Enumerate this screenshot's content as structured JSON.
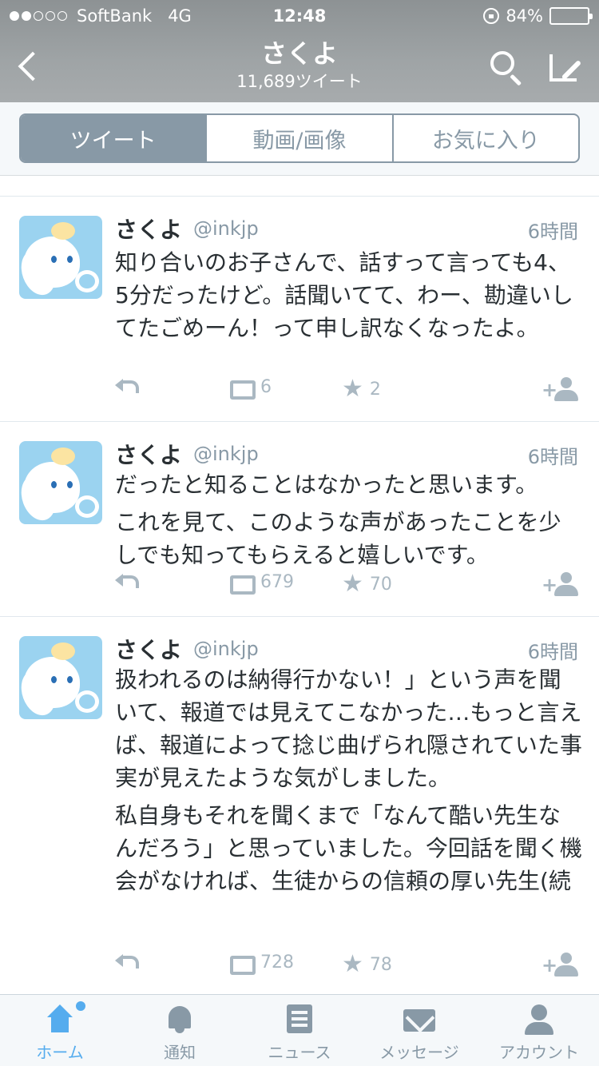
{
  "status_bar": {
    "carrier": "SoftBank",
    "network": "4G",
    "time": "12:48",
    "battery": "84%",
    "battery_level": 0.84
  },
  "nav": {
    "title": "さくよ",
    "subtitle": "11,689ツイート"
  },
  "tabs": [
    {
      "label": "ツイート",
      "active": true
    },
    {
      "label": "動画/画像",
      "active": false
    },
    {
      "label": "お気に入り",
      "active": false
    }
  ],
  "tweets": [
    {
      "name": "さくよ",
      "handle": "@inkjp",
      "time": "6時間",
      "paragraphs": [
        "知り合いのお子さんで、話すって言っても4、5分だったけど。話聞いてて、わー、勘違いしてたごめーん！って申し訳なくなったよ。"
      ],
      "retweets": "6",
      "favorites": "2"
    },
    {
      "name": "さくよ",
      "handle": "@inkjp",
      "time": "6時間",
      "paragraphs": [
        "だったと知ることはなかったと思います。",
        "これを見て、このような声があったことを少しでも知ってもらえると嬉しいです。"
      ],
      "retweets": "679",
      "favorites": "70"
    },
    {
      "name": "さくよ",
      "handle": "@inkjp",
      "time": "6時間",
      "paragraphs": [
        "扱われるのは納得行かない！」という声を聞いて、報道では見えてこなかった…もっと言えば、報道によって捻じ曲げられ隠されていた事実が見えたような気がしました。",
        "私自身もそれを聞くまで「なんて酷い先生なんだろう」と思っていました。今回話を聞く機会がなければ、生徒からの信頼の厚い先生(続"
      ],
      "retweets": "728",
      "favorites": "78"
    }
  ],
  "tabbar": [
    {
      "label": "ホーム",
      "icon": "home-icon",
      "active": true
    },
    {
      "label": "通知",
      "icon": "bell-icon",
      "active": false
    },
    {
      "label": "ニュース",
      "icon": "news-icon",
      "active": false
    },
    {
      "label": "メッセージ",
      "icon": "mail-icon",
      "active": false
    },
    {
      "label": "アカウント",
      "icon": "user-icon",
      "active": false
    }
  ],
  "colors": {
    "accent": "#55acee",
    "muted": "#8899a6",
    "header": "#9a9fa1"
  }
}
